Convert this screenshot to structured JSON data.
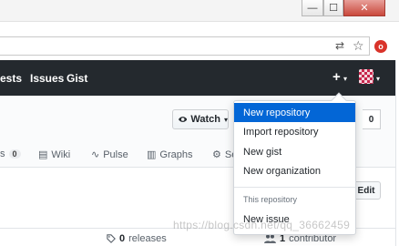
{
  "window": {
    "minimize": "—",
    "maximize": "☐",
    "close": "✕"
  },
  "toolbar": {
    "translate_icon": "⇄",
    "star_icon": "☆",
    "extension_label": "o"
  },
  "header": {
    "nav": [
      "ests",
      "Issues",
      "Gist"
    ],
    "plus_icon": "+",
    "plus_caret": "▾",
    "avatar_caret": "▾"
  },
  "repo": {
    "watch_label": "Watch",
    "watch_caret": "▾",
    "count_value": "0"
  },
  "tabs": [
    {
      "label": "s",
      "count": "0",
      "icon": ""
    },
    {
      "label": "Wiki",
      "icon": "▤"
    },
    {
      "label": "Pulse",
      "icon": "∿"
    },
    {
      "label": "Graphs",
      "icon": "▥"
    },
    {
      "label": "Se",
      "icon": "⚙"
    }
  ],
  "edit_label": "Edit",
  "summary": {
    "releases_count": "0",
    "releases_label": "releases",
    "contributors_count": "1",
    "contributors_label": "contributor",
    "releases_icon": "🏷",
    "contributors_icon": "👥"
  },
  "dropdown": {
    "items": [
      "New repository",
      "Import repository",
      "New gist",
      "New organization"
    ],
    "section_header": "This repository",
    "section_items": [
      "New issue"
    ]
  },
  "watermark": "https://blog.csdn.net/qq_36662459"
}
